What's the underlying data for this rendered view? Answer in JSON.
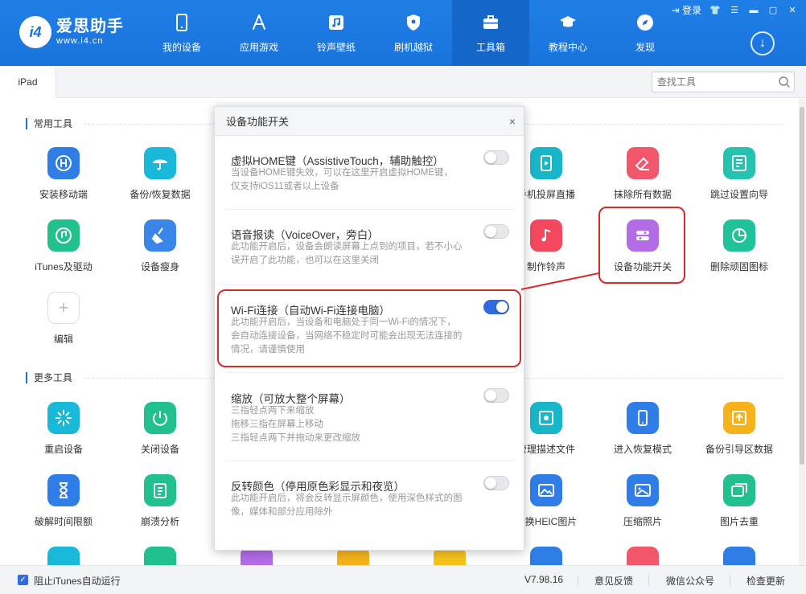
{
  "app": {
    "name": "爱思助手",
    "url": "www.i4.cn",
    "badge": "i4",
    "login": "登录"
  },
  "nav": [
    {
      "label": "我的设备",
      "icon": "phone-icon"
    },
    {
      "label": "应用游戏",
      "icon": "appstore-icon"
    },
    {
      "label": "铃声壁纸",
      "icon": "music-icon"
    },
    {
      "label": "刷机越狱",
      "icon": "shield-icon"
    },
    {
      "label": "工具箱",
      "icon": "toolbox-icon",
      "active": true
    },
    {
      "label": "教程中心",
      "icon": "graduation-icon"
    },
    {
      "label": "发现",
      "icon": "compass-icon"
    }
  ],
  "tab": {
    "label": "iPad"
  },
  "search": {
    "placeholder": "查找工具"
  },
  "sections": {
    "common": "常用工具",
    "more": "更多工具"
  },
  "tools_common": [
    {
      "label": "安装移动端",
      "color": "#2f7de6"
    },
    {
      "label": "备份/恢复数据",
      "color": "#19b8d8"
    },
    {
      "label": "手机投屏直播",
      "color": "#19b5c8"
    },
    {
      "label": "抹除所有数据",
      "color": "#f2566a"
    },
    {
      "label": "跳过设置向导",
      "color": "#26c2b0"
    },
    {
      "label": "iTunes及驱动",
      "color": "#22c08e"
    },
    {
      "label": "设备瘦身",
      "color": "#3a86e8"
    },
    {
      "label": "制作铃声",
      "color": "#f3485e"
    },
    {
      "label": "设备功能开关",
      "color": "#b36be8"
    },
    {
      "label": "删除顽固图标",
      "color": "#20c29a"
    },
    {
      "label": "编辑"
    }
  ],
  "tools_more": [
    {
      "label": "重启设备",
      "color": "#19b8d8"
    },
    {
      "label": "关闭设备",
      "color": "#22c08e"
    },
    {
      "label": "管理描述文件",
      "color": "#19b5c8"
    },
    {
      "label": "进入恢复模式",
      "color": "#2f7de6"
    },
    {
      "label": "备份引导区数据",
      "color": "#f5b21a"
    },
    {
      "label": "破解时间限额",
      "color": "#2f7de6"
    },
    {
      "label": "崩溃分析",
      "color": "#22c08e"
    },
    {
      "label": "转换HEIC图片",
      "color": "#2f7de6"
    },
    {
      "label": "压缩照片",
      "color": "#2f7de6"
    },
    {
      "label": "图片去重",
      "color": "#22c08e"
    }
  ],
  "dialog": {
    "title": "设备功能开关",
    "close": "×",
    "options": [
      {
        "title": "虚拟HOME键（AssistiveTouch，辅助触控）",
        "desc": [
          "当设备HOME键失效，可以在这里开启虚拟HOME键，",
          "仅支持iOS11或者以上设备"
        ],
        "on": false
      },
      {
        "title": "语音报读（VoiceOver，旁白）",
        "desc": [
          "此功能开启后，设备会朗读屏幕上点到的项目，若不小心",
          "误开启了此功能，也可以在这里关闭"
        ],
        "on": false
      },
      {
        "title": "Wi-Fi连接（自动Wi-Fi连接电脑）",
        "desc": [
          "此功能开启后，当设备和电脑处于同一Wi-Fi的情况下，",
          "会自动连接设备，当网络不稳定时可能会出现无法连接的",
          "情况，请谨慎使用"
        ],
        "on": true
      },
      {
        "title": "缩放（可放大整个屏幕）",
        "desc": [
          "三指轻点两下来缩放",
          "拖移三指在屏幕上移动",
          "三指轻点两下并拖动来更改缩放"
        ],
        "on": false
      },
      {
        "title": "反转颜色（停用原色彩显示和夜览）",
        "desc": [
          "此功能开启后，将会反转显示屏颜色，使用深色样式的图",
          "像，媒体和部分应用除外"
        ],
        "on": false
      }
    ]
  },
  "footer": {
    "checkbox_label": "阻止iTunes自动运行",
    "version": "V7.98.16",
    "feedback": "意见反馈",
    "wechat": "微信公众号",
    "update": "检查更新"
  }
}
